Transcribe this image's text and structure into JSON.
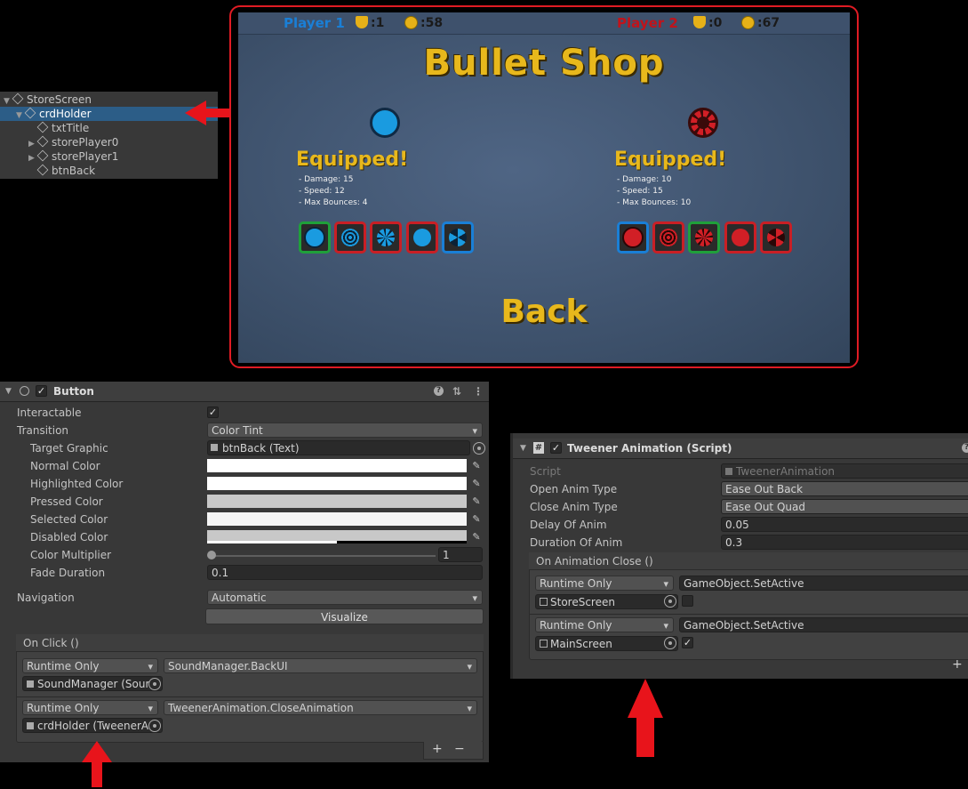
{
  "hierarchy": {
    "items": [
      {
        "label": "StoreScreen"
      },
      {
        "label": "crdHolder"
      },
      {
        "label": "txtTitle"
      },
      {
        "label": "storePlayer0"
      },
      {
        "label": "storePlayer1"
      },
      {
        "label": "btnBack"
      }
    ]
  },
  "game": {
    "p1": {
      "name": "Player 1",
      "trophies": ":1",
      "coins": ":58",
      "equipped": "Equipped!",
      "damage": "- Damage: 15",
      "speed": "- Speed: 12",
      "bounces": "- Max Bounces: 4"
    },
    "p2": {
      "name": "Player 2",
      "trophies": ":0",
      "coins": ":67",
      "equipped": "Equipped!",
      "damage": "- Damage: 10",
      "speed": "- Speed: 15",
      "bounces": "- Max Bounces: 10"
    },
    "title": "Bullet Shop",
    "back": "Back",
    "colors": {
      "p1": "#1a9be0",
      "p2": "#d11f26",
      "gold": "#e8b81c"
    }
  },
  "button_inspector": {
    "title": "Button",
    "interactable_label": "Interactable",
    "interactable_check": "✓",
    "transition_label": "Transition",
    "transition_value": "Color Tint",
    "target_graphic_label": "Target Graphic",
    "target_graphic_value": "btnBack (Text)",
    "normal_label": "Normal Color",
    "highlighted_label": "Highlighted Color",
    "pressed_label": "Pressed Color",
    "selected_label": "Selected Color",
    "disabled_label": "Disabled Color",
    "multiplier_label": "Color Multiplier",
    "multiplier_value": "1",
    "fade_label": "Fade Duration",
    "fade_value": "0.1",
    "navigation_label": "Navigation",
    "navigation_value": "Automatic",
    "visualize": "Visualize",
    "onclick_label": "On Click ()",
    "events": [
      {
        "mode": "Runtime Only",
        "func": "SoundManager.BackUI",
        "target": "SoundManager (Sour"
      },
      {
        "mode": "Runtime Only",
        "func": "TweenerAnimation.CloseAnimation",
        "target": "crdHolder (TweenerA"
      }
    ],
    "plus": "+",
    "minus": "−"
  },
  "tweener_inspector": {
    "title": "Tweener Animation (Script)",
    "check": "✓",
    "script_label": "Script",
    "script_value": "TweenerAnimation",
    "open_label": "Open Anim Type",
    "open_value": "Ease Out Back",
    "close_label": "Close Anim Type",
    "close_value": "Ease Out Quad",
    "delay_label": "Delay Of Anim",
    "delay_value": "0.05",
    "duration_label": "Duration Of Anim",
    "duration_value": "0.3",
    "onclose_label": "On Animation Close ()",
    "events": [
      {
        "mode": "Runtime Only",
        "func": "GameObject.SetActive",
        "target": "StoreScreen",
        "checked": ""
      },
      {
        "mode": "Runtime Only",
        "func": "GameObject.SetActive",
        "target": "MainScreen",
        "checked": "✓"
      }
    ],
    "plus": "+"
  }
}
